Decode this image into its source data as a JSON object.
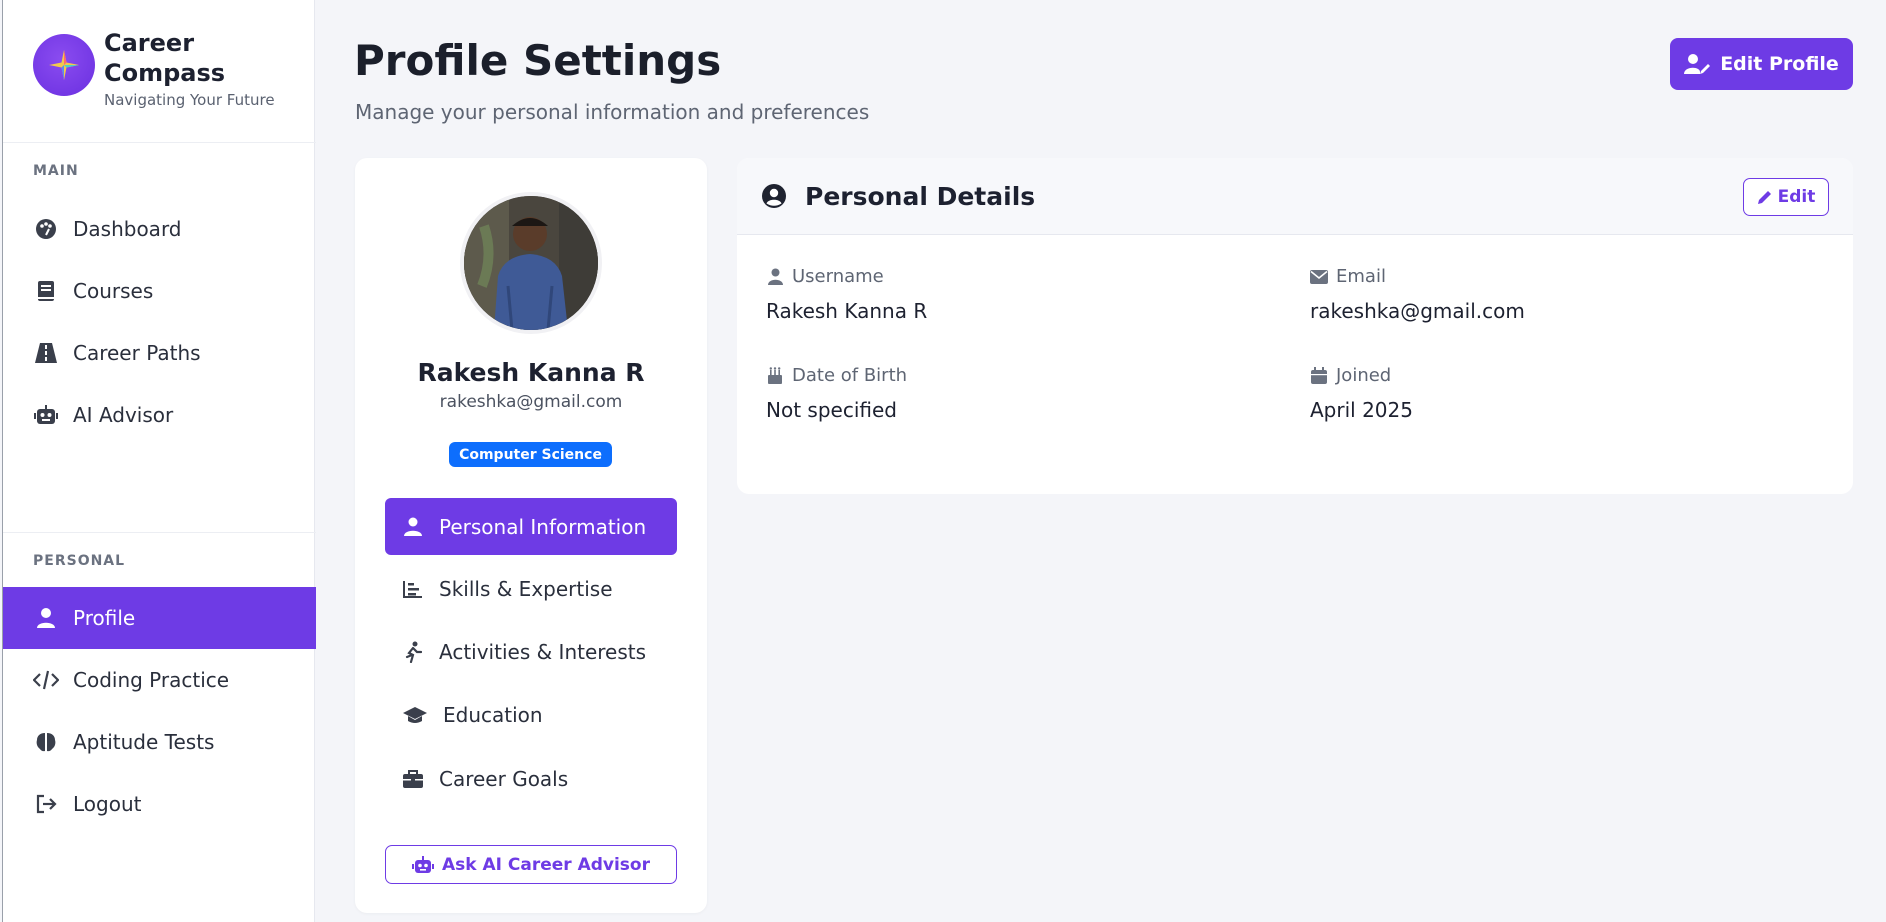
{
  "brand": {
    "title": "Career Compass",
    "subtitle": "Navigating Your Future"
  },
  "sidebar": {
    "main_label": "MAIN",
    "main_items": [
      {
        "label": "Dashboard",
        "icon": "palette-icon"
      },
      {
        "label": "Courses",
        "icon": "book-icon"
      },
      {
        "label": "Career Paths",
        "icon": "road-icon"
      },
      {
        "label": "AI Advisor",
        "icon": "robot-icon"
      }
    ],
    "personal_label": "PERSONAL",
    "personal_items": [
      {
        "label": "Profile",
        "icon": "user-icon",
        "active": true
      },
      {
        "label": "Coding Practice",
        "icon": "code-icon"
      },
      {
        "label": "Aptitude Tests",
        "icon": "brain-icon"
      },
      {
        "label": "Logout",
        "icon": "logout-icon"
      }
    ]
  },
  "header": {
    "title": "Profile Settings",
    "subtitle": "Manage your personal information and preferences",
    "edit_profile_label": "Edit Profile"
  },
  "profile": {
    "name": "Rakesh Kanna R",
    "email": "rakeshka@gmail.com",
    "badge": "Computer Science",
    "menu": [
      {
        "label": "Personal Information",
        "icon": "user-icon",
        "active": true
      },
      {
        "label": "Skills & Expertise",
        "icon": "chart-bar-icon"
      },
      {
        "label": "Activities & Interests",
        "icon": "running-icon"
      },
      {
        "label": "Education",
        "icon": "graduation-cap-icon"
      },
      {
        "label": "Career Goals",
        "icon": "briefcase-icon"
      }
    ],
    "ask_advisor_label": "Ask AI Career Advisor"
  },
  "details": {
    "title": "Personal Details",
    "edit_label": "Edit",
    "fields": [
      {
        "label": "Username",
        "value": "Rakesh Kanna R",
        "icon": "user-icon"
      },
      {
        "label": "Email",
        "value": "rakeshka@gmail.com",
        "icon": "envelope-icon"
      },
      {
        "label": "Date of Birth",
        "value": "Not specified",
        "icon": "birthday-cake-icon"
      },
      {
        "label": "Joined",
        "value": "April 2025",
        "icon": "calendar-icon"
      }
    ]
  },
  "colors": {
    "accent": "#6e3be5",
    "badge": "#0d6efd",
    "background": "#f4f5f9"
  }
}
